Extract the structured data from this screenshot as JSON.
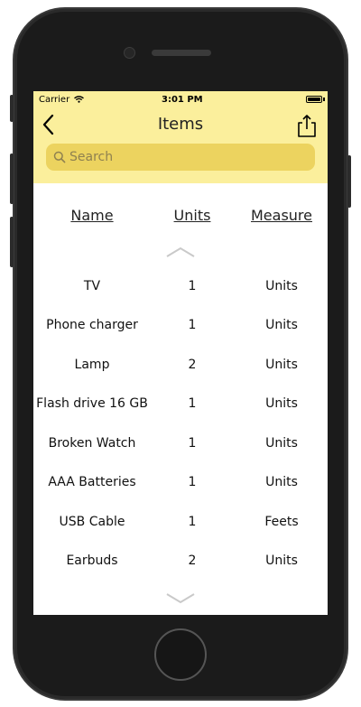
{
  "status": {
    "carrier": "Carrier",
    "time": "3:01 PM"
  },
  "nav": {
    "title": "Items"
  },
  "search": {
    "placeholder": "Search"
  },
  "columns": {
    "name": "Name",
    "units": "Units",
    "measure": "Measure"
  },
  "rows": [
    {
      "name": "TV",
      "units": "1",
      "measure": "Units"
    },
    {
      "name": "Phone charger",
      "units": "1",
      "measure": "Units"
    },
    {
      "name": "Lamp",
      "units": "2",
      "measure": "Units"
    },
    {
      "name": "Flash drive 16 GB",
      "units": "1",
      "measure": "Units"
    },
    {
      "name": "Broken Watch",
      "units": "1",
      "measure": "Units"
    },
    {
      "name": "AAA Batteries",
      "units": "1",
      "measure": "Units"
    },
    {
      "name": "USB Cable",
      "units": "1",
      "measure": "Feets"
    },
    {
      "name": "Earbuds",
      "units": "2",
      "measure": "Units"
    }
  ],
  "icons": {
    "back": "chevron-left-icon",
    "share": "share-icon",
    "search": "magnifier-icon",
    "scroll_up": "chevron-up-icon",
    "scroll_down": "chevron-down-icon"
  },
  "colors": {
    "header": "#fbef9c",
    "search_field": "#ecd35f",
    "device": "#1b1b1b"
  }
}
